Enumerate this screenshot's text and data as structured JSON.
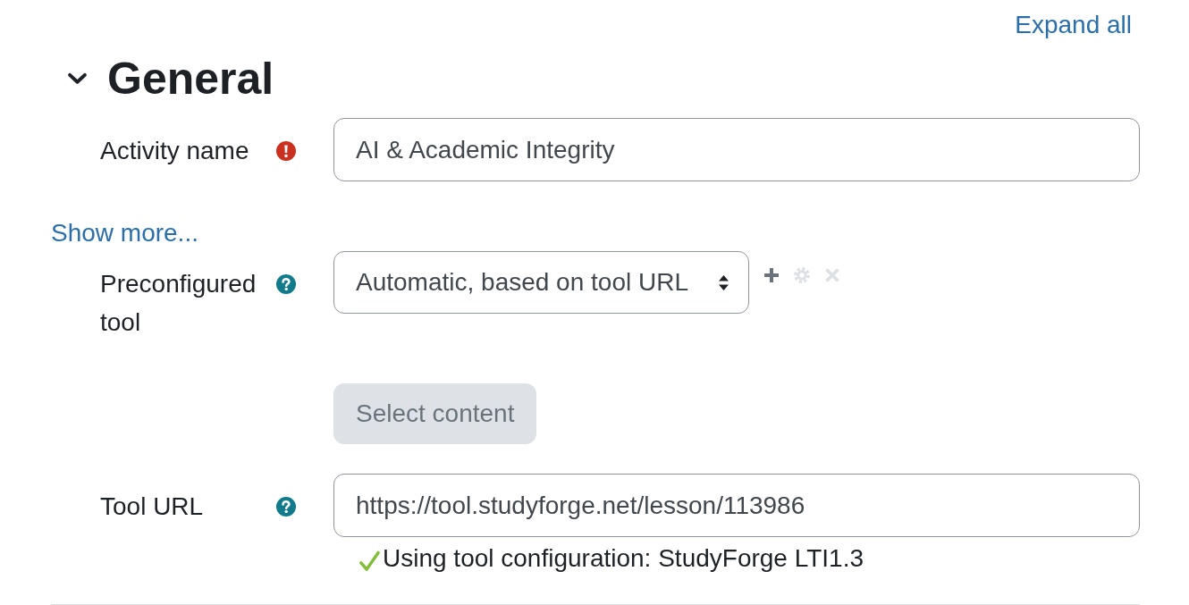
{
  "expand_all": {
    "label": "Expand all"
  },
  "section": {
    "title": "General",
    "expanded": true,
    "items": [
      {
        "kind": "text_field",
        "label": "Activity name",
        "required": true,
        "help": false,
        "value": "AI & Academic Integrity"
      },
      {
        "kind": "link",
        "label": "Show more..."
      },
      {
        "kind": "select",
        "label": "Preconfigured tool",
        "required": false,
        "help": true,
        "value": "Automatic, based on tool URL",
        "actions": [
          {
            "kind": "add",
            "disabled": false
          },
          {
            "kind": "settings",
            "disabled": true
          },
          {
            "kind": "delete",
            "disabled": true
          }
        ]
      },
      {
        "kind": "button",
        "label": "Select content",
        "disabled": true
      },
      {
        "kind": "text_field",
        "label": "Tool URL",
        "required": false,
        "help": true,
        "value": "https://tool.studyforge.net/lesson/113986",
        "note": "Using tool configuration: StudyForge LTI1.3"
      }
    ]
  }
}
